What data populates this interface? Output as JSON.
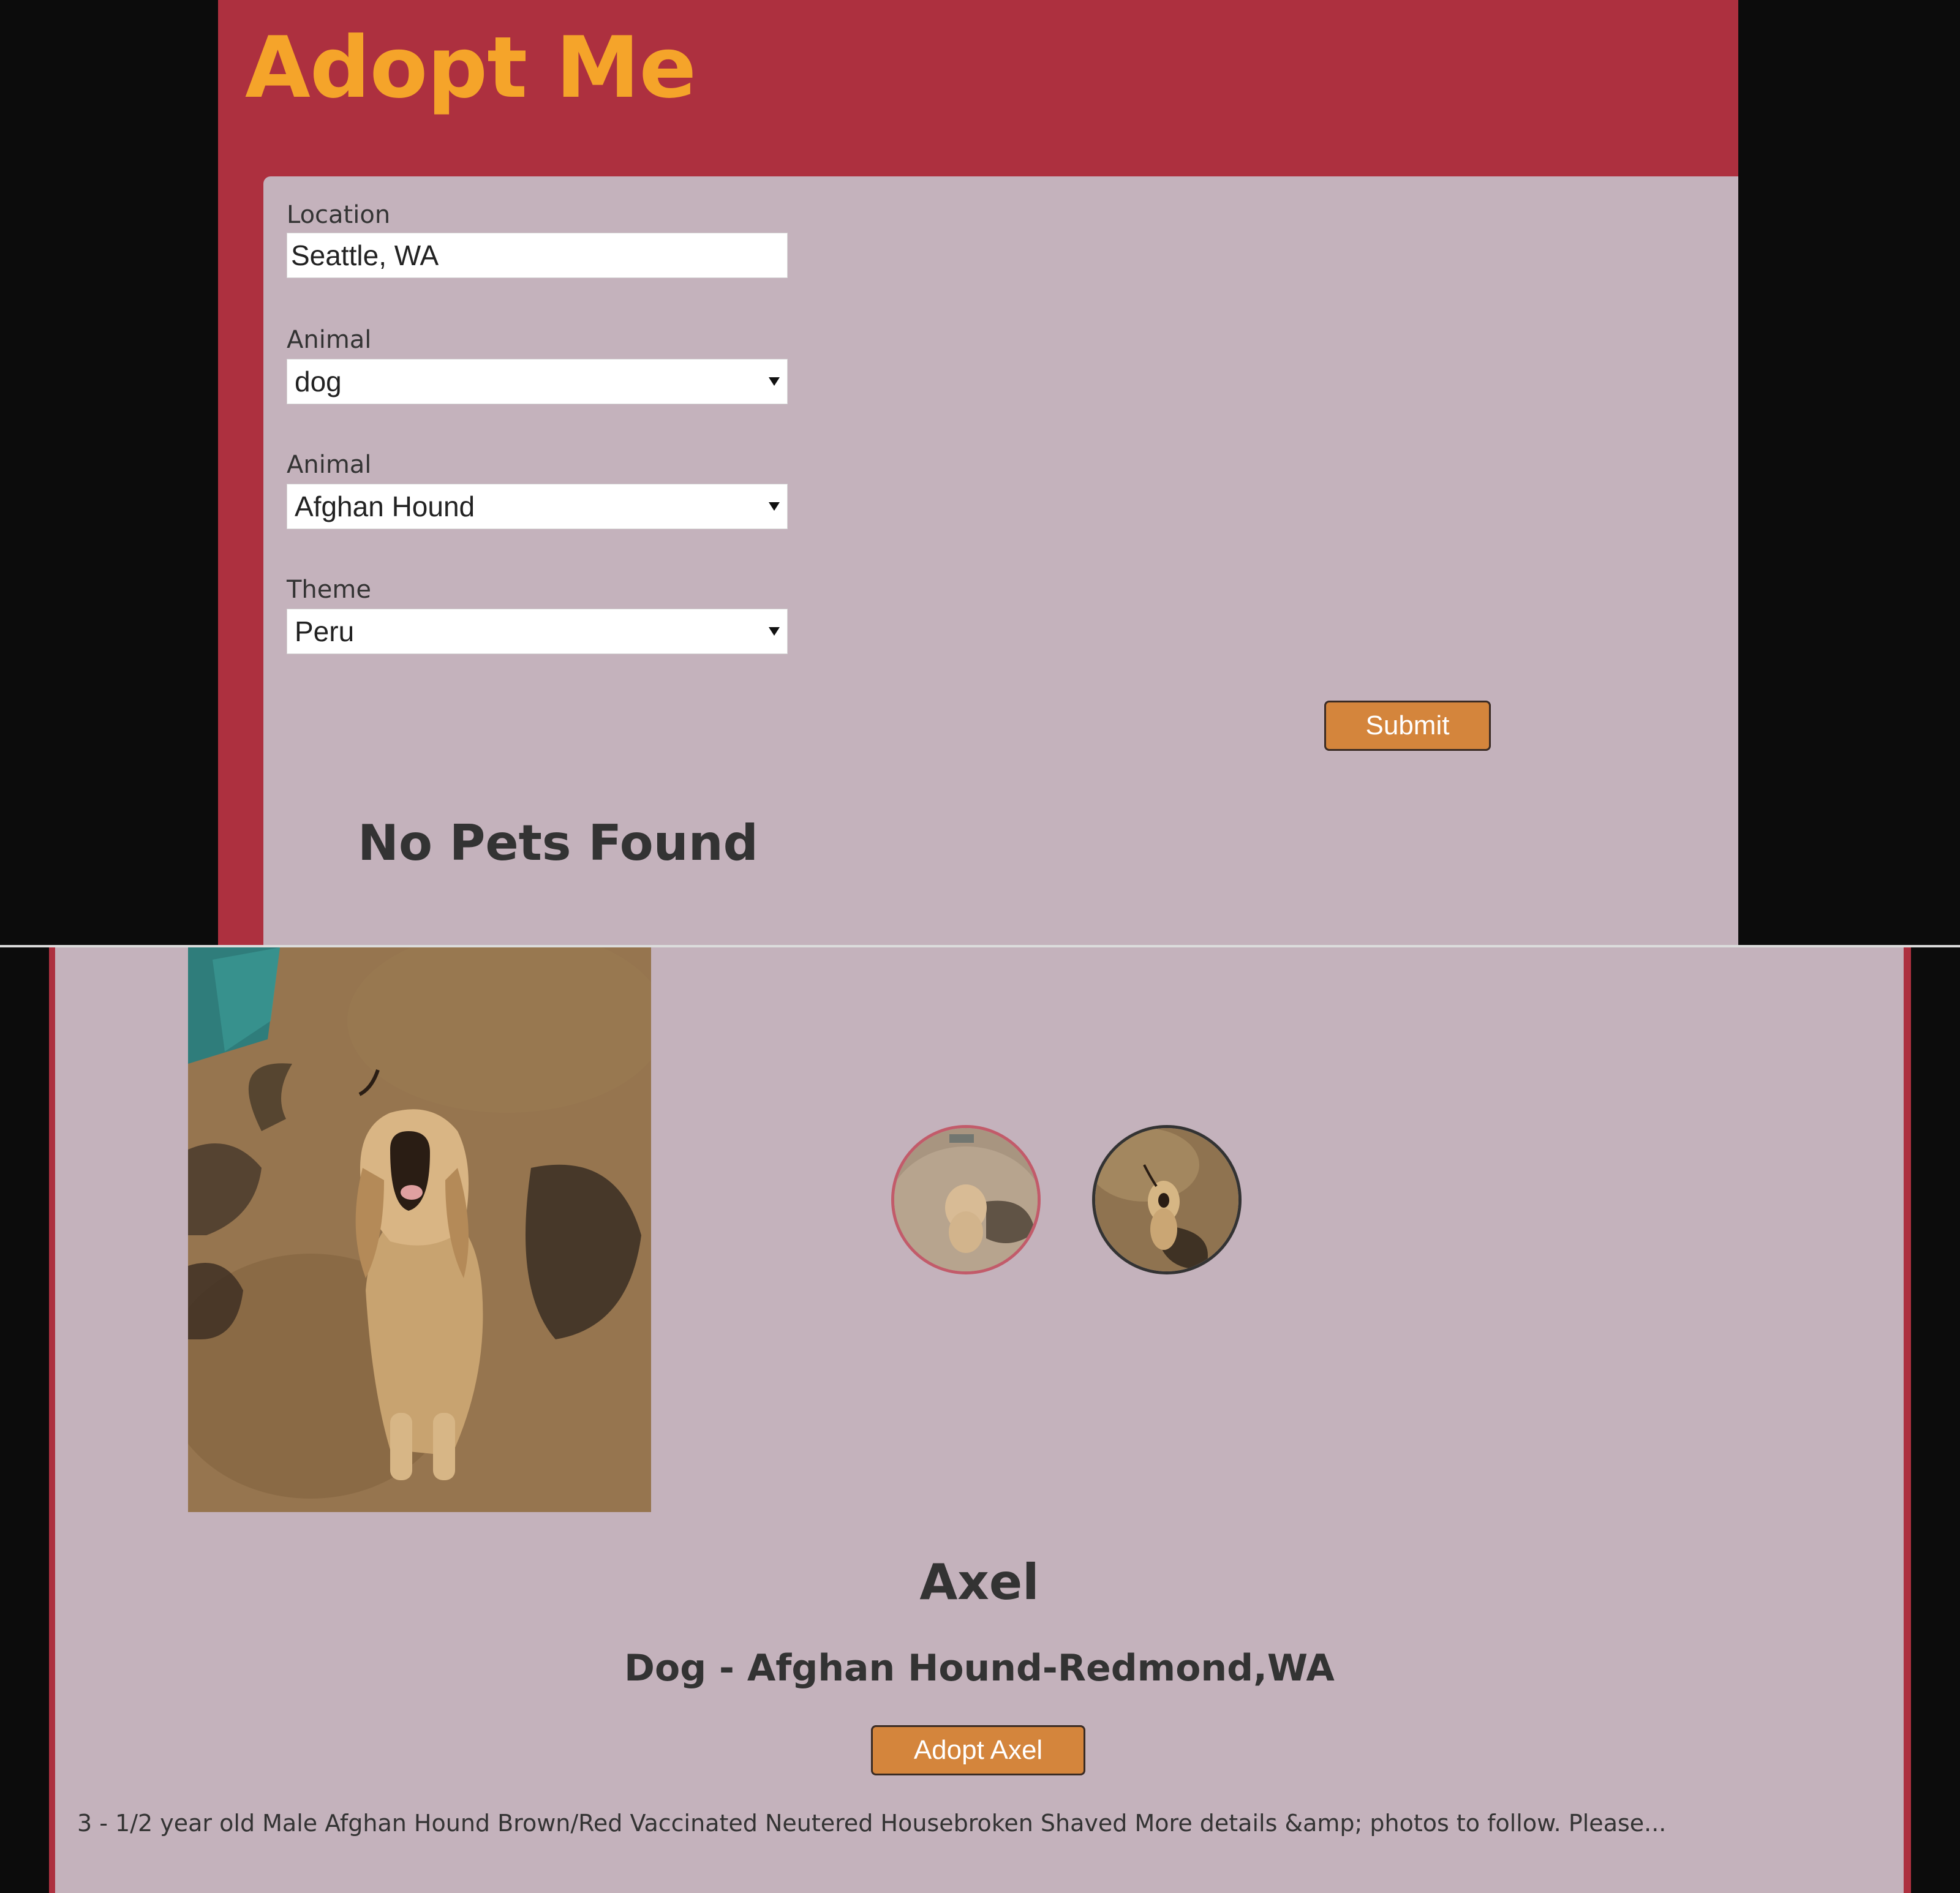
{
  "header": {
    "title": "Adopt Me"
  },
  "search_form": {
    "location": {
      "label": "Location",
      "value": "Seattle, WA"
    },
    "animal": {
      "label": "Animal",
      "value": "dog"
    },
    "breed": {
      "label": "Animal",
      "value": "Afghan Hound"
    },
    "theme": {
      "label": "Theme",
      "value": "Peru"
    },
    "submit_label": "Submit"
  },
  "results": {
    "empty_message": "No Pets Found"
  },
  "details": {
    "name": "Axel",
    "subtitle": "Dog - Afghan Hound-Redmond,WA",
    "adopt_label": "Adopt Axel",
    "description": "3 - 1/2 year old Male Afghan Hound Brown/Red Vaccinated Neutered Housebroken Shaved More details &amp; photos to follow. Please..."
  },
  "colors": {
    "header_bg": "#ad303f",
    "title": "#f5a42a",
    "card_bg": "#c4b2bc",
    "button_bg": "#d4853c",
    "page_bg": "#0c0c0c"
  }
}
